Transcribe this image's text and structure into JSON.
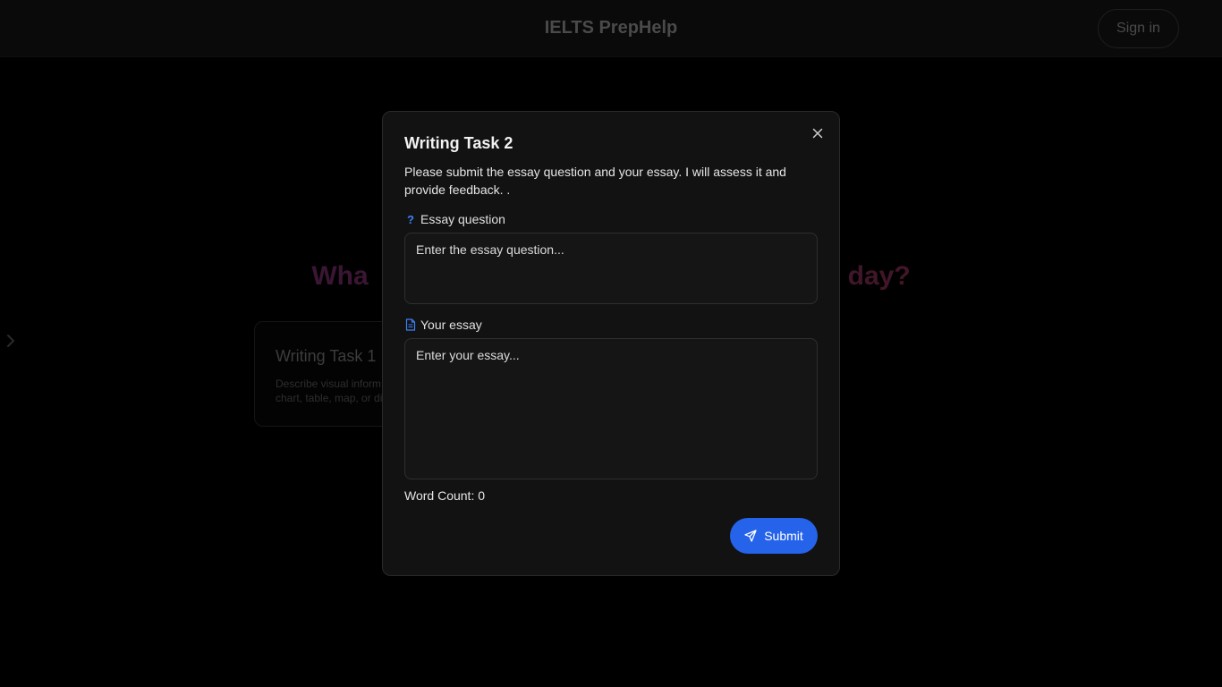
{
  "header": {
    "brand": "IELTS PrepHelp",
    "signin_label": "Sign in"
  },
  "hero": {
    "visible_text_left": "Wha",
    "visible_text_right": "day?"
  },
  "card1": {
    "title": "Writing Task 1",
    "desc_line1": "Describe visual inform",
    "desc_line2": "chart, table, map, or di"
  },
  "modal": {
    "title": "Writing Task 2",
    "description": "Please submit the essay question and your essay. I will assess it and provide feedback. .",
    "question_label": "Essay question",
    "question_icon": "?",
    "question_placeholder": "Enter the essay question...",
    "essay_label": "Your essay",
    "essay_placeholder": "Enter your essay...",
    "word_count_label": "Word Count: 0",
    "submit_label": "Submit"
  },
  "colors": {
    "accent": "#2563eb",
    "modal_bg": "#121212",
    "page_bg": "#000000"
  }
}
